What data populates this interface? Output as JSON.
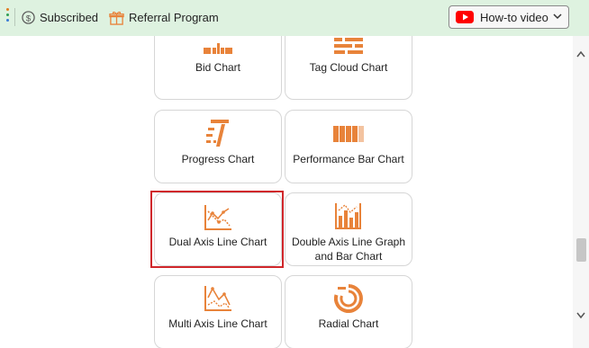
{
  "topbar": {
    "subscribed_label": "Subscribed",
    "referral_label": "Referral Program",
    "howto_label": "How-to video"
  },
  "icons": {
    "subscribed": "dollar-circle-icon",
    "referral": "gift-icon",
    "howto": "youtube-icon",
    "dropdown": "chevron-down-icon"
  },
  "colors": {
    "accent": "#e8833a",
    "topbar_bg": "#def2e0",
    "selection_border": "#d0272b",
    "youtube_red": "#ff0000"
  },
  "cards": [
    {
      "label": "Bid Chart",
      "icon": "bid-chart-icon"
    },
    {
      "label": "Tag Cloud Chart",
      "icon": "tag-cloud-chart-icon"
    },
    {
      "label": "Progress Chart",
      "icon": "progress-chart-icon"
    },
    {
      "label": "Performance Bar Chart",
      "icon": "performance-bar-chart-icon"
    },
    {
      "label": "Dual Axis Line Chart",
      "icon": "dual-axis-line-chart-icon",
      "selected": true
    },
    {
      "label": "Double Axis Line Graph and Bar Chart",
      "icon": "double-axis-line-bar-chart-icon"
    },
    {
      "label": "Multi Axis Line Chart",
      "icon": "multi-axis-line-chart-icon"
    },
    {
      "label": "Radial Chart",
      "icon": "radial-chart-icon"
    }
  ]
}
